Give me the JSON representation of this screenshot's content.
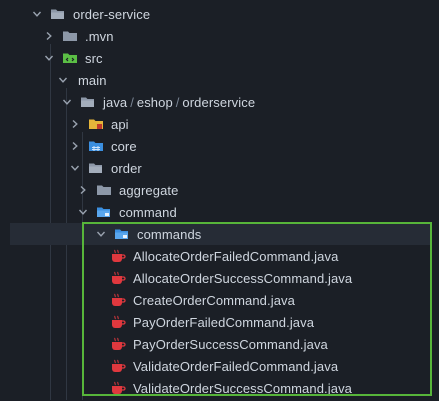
{
  "tree": {
    "root": {
      "label": "order-service",
      "icon": "folder-open-icon"
    },
    "mvn": {
      "label": ".mvn",
      "icon": "folder-icon"
    },
    "src": {
      "label": "src",
      "icon": "source-folder-icon"
    },
    "main": {
      "label": "main",
      "icon": "folder-open-icon"
    },
    "package": {
      "segments": [
        "java",
        "eshop",
        "orderservice"
      ],
      "separator": "/",
      "icon": "folder-open-icon"
    },
    "api": {
      "label": "api",
      "icon": "api-folder-icon"
    },
    "core": {
      "label": "core",
      "icon": "core-folder-icon"
    },
    "order": {
      "label": "order",
      "icon": "folder-open-icon"
    },
    "aggregate": {
      "label": "aggregate",
      "icon": "folder-icon"
    },
    "command": {
      "label": "command",
      "icon": "command-folder-open-icon"
    },
    "commands": {
      "label": "commands",
      "icon": "command-folder-open-icon"
    },
    "files": [
      "AllocateOrderFailedCommand.java",
      "AllocateOrderSuccessCommand.java",
      "CreateOrderCommand.java",
      "PayOrderFailedCommand.java",
      "PayOrderSuccessCommand.java",
      "ValidateOrderFailedCommand.java",
      "ValidateOrderSuccessCommand.java"
    ],
    "file_icon": "java-file-icon"
  },
  "colors": {
    "background": "#1b1f26",
    "text": "#cfd6df",
    "highlight_border": "#57b53a",
    "selected_row": "#262c36",
    "java_icon": "#e0383e",
    "folder": "#8d98a8",
    "blue_folder": "#3b8fe0",
    "src_folder": "#5bbf45",
    "api_folder": "#e5b53a"
  }
}
